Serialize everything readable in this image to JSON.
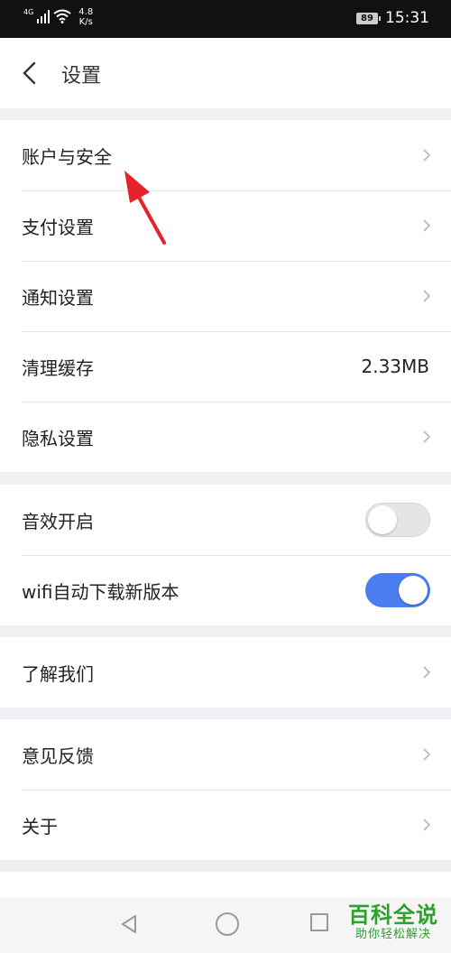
{
  "status_bar": {
    "network": "4G",
    "speed_value": "4.8",
    "speed_unit": "K/s",
    "battery": "89",
    "time": "15:31"
  },
  "header": {
    "title": "设置"
  },
  "groups": [
    {
      "items": [
        {
          "label": "账户与安全"
        },
        {
          "label": "支付设置"
        },
        {
          "label": "通知设置"
        },
        {
          "label": "清理缓存",
          "value": "2.33MB"
        },
        {
          "label": "隐私设置"
        }
      ]
    },
    {
      "items": [
        {
          "label": "音效开启",
          "toggle": false
        },
        {
          "label": "wifi自动下载新版本",
          "toggle": true
        }
      ]
    },
    {
      "items": [
        {
          "label": "了解我们"
        }
      ]
    },
    {
      "items": [
        {
          "label": "意见反馈"
        },
        {
          "label": "关于"
        }
      ]
    }
  ],
  "watermark": {
    "title": "百科全说",
    "subtitle": "助你轻松解决"
  },
  "colors": {
    "toggle_on": "#4a7ef0",
    "toggle_off": "#e5e5e5",
    "annotation_arrow": "#e8222a",
    "watermark": "#2ea02e"
  }
}
